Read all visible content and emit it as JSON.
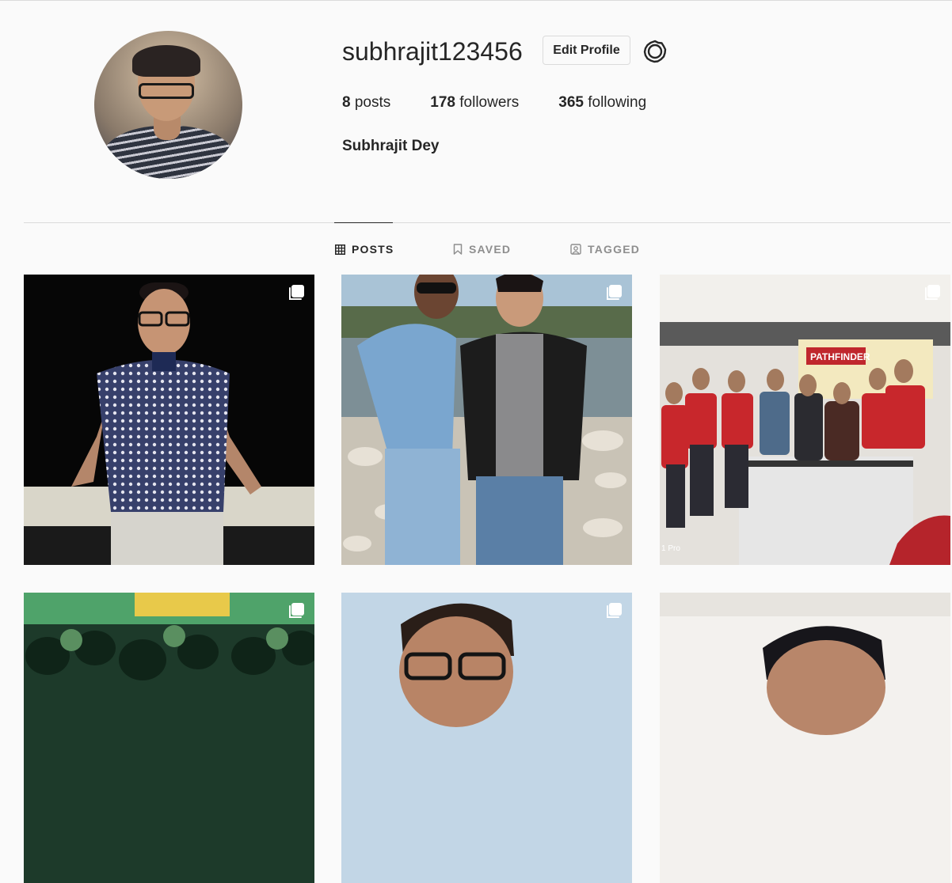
{
  "profile": {
    "username": "subhrajit123456",
    "edit_profile_label": "Edit Profile",
    "full_name": "Subhrajit Dey",
    "stats": {
      "posts_count": "8",
      "posts_label": "posts",
      "followers_count": "178",
      "followers_label": "followers",
      "following_count": "365",
      "following_label": "following"
    }
  },
  "tabs": [
    {
      "label": "POSTS",
      "icon": "grid-icon",
      "active": true
    },
    {
      "label": "SAVED",
      "icon": "bookmark-icon",
      "active": false
    },
    {
      "label": "TAGGED",
      "icon": "tagged-user-icon",
      "active": false
    }
  ],
  "posts": [
    {
      "overlay_icon": "multiple-photos-icon",
      "content": "man standing at railing at night"
    },
    {
      "overlay_icon": "multiple-photos-icon",
      "content": "two friends on riverbank rocks"
    },
    {
      "overlay_icon": "multiple-photos-icon",
      "content": "group photo in office"
    },
    {
      "overlay_icon": "multiple-photos-icon",
      "content": "crowd at event"
    },
    {
      "overlay_icon": "multiple-photos-icon",
      "content": "selfie outdoors"
    },
    {
      "overlay_icon": "none",
      "content": "close-up portrait"
    }
  ],
  "photo_text": {
    "banner_title": "PATHFINDER",
    "watermark": "1 Pro"
  },
  "colors": {
    "background": "#fafafa",
    "text": "#262626",
    "muted": "#8e8e8e",
    "border": "#dbdbdb"
  }
}
